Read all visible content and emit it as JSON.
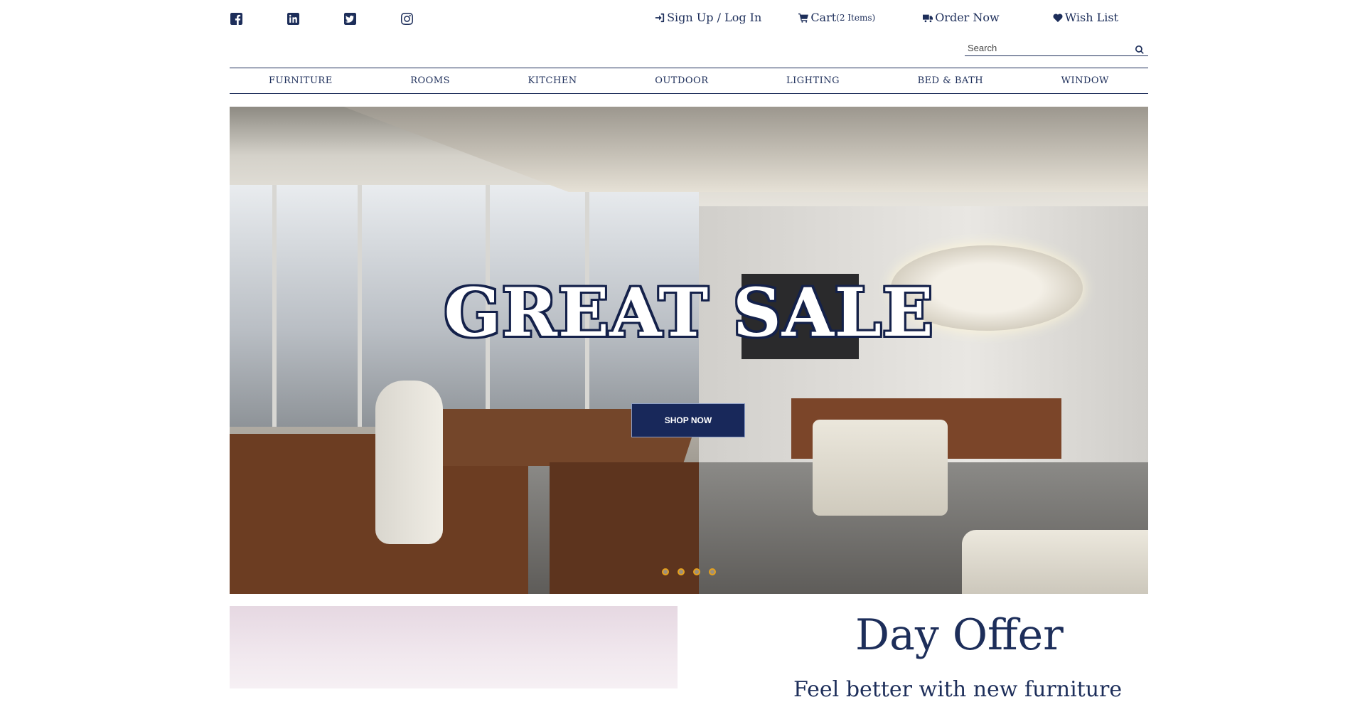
{
  "social": [
    {
      "name": "facebook-icon"
    },
    {
      "name": "linkedin-icon"
    },
    {
      "name": "twitter-icon"
    },
    {
      "name": "instagram-icon"
    }
  ],
  "toplinks": {
    "sign_in": "Sign Up / Log In",
    "cart": "Cart",
    "cart_count": "(2 Items)",
    "order": "Order Now",
    "wishlist": "Wish List"
  },
  "search": {
    "placeholder": "Search"
  },
  "nav": {
    "items": [
      "FURNITURE",
      "ROOMS",
      "KITCHEN",
      "OUTDOOR",
      "LIGHTING",
      "BED & BATH",
      "WINDOW"
    ]
  },
  "hero": {
    "headline": "GREAT SALE",
    "cta": "SHOP NOW",
    "slides": 4
  },
  "offer": {
    "title": "Day Offer",
    "tagline": "Feel better with new furniture"
  },
  "colors": {
    "brand": "#1d2e5a",
    "button": "#18285a",
    "dot_accent": "#e6a11d"
  }
}
